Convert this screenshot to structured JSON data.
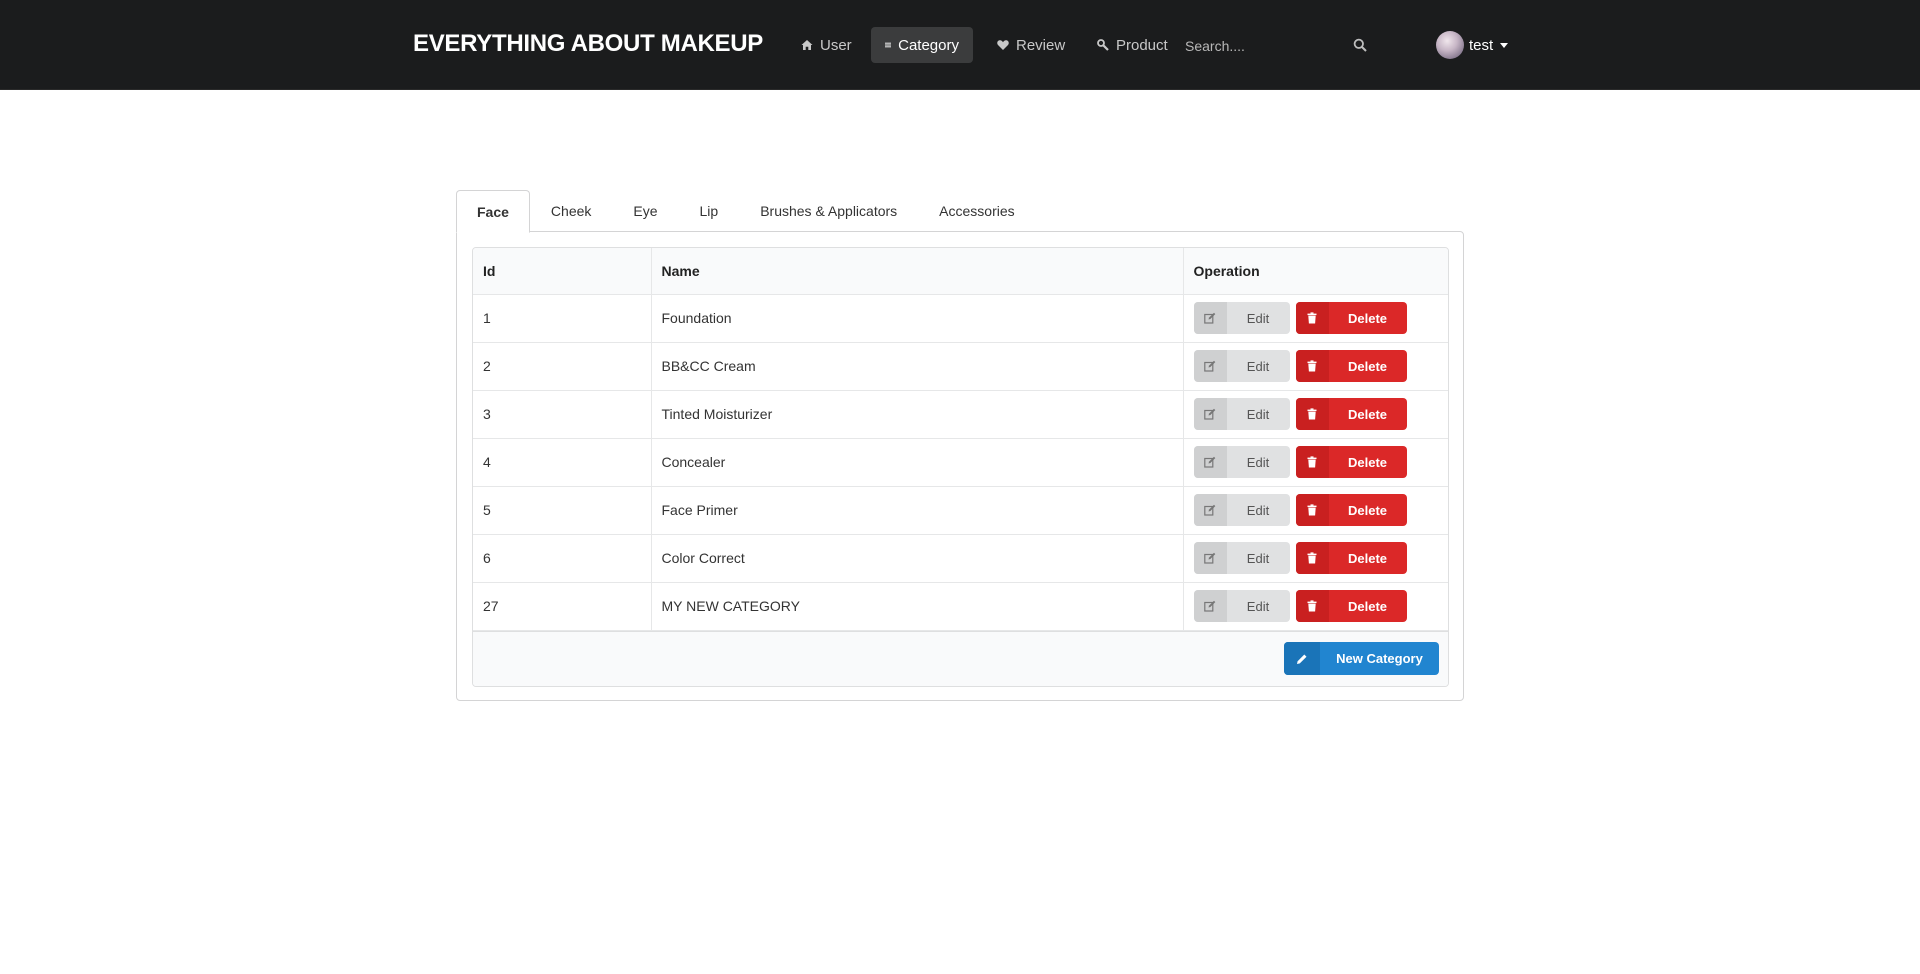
{
  "nav": {
    "brand": "EVERYTHING ABOUT MAKEUP",
    "items": [
      {
        "label": "User",
        "icon": "home-icon"
      },
      {
        "label": "Category",
        "icon": "list-icon",
        "active": true
      },
      {
        "label": "Review",
        "icon": "heart-icon"
      },
      {
        "label": "Product",
        "icon": "wrench-icon"
      }
    ],
    "search": {
      "placeholder": "Search....",
      "value": ""
    },
    "user": {
      "name": "test"
    }
  },
  "tabs": [
    {
      "label": "Face",
      "active": true
    },
    {
      "label": "Cheek"
    },
    {
      "label": "Eye"
    },
    {
      "label": "Lip"
    },
    {
      "label": "Brushes & Applicators"
    },
    {
      "label": "Accessories"
    }
  ],
  "table": {
    "headers": {
      "id": "Id",
      "name": "Name",
      "operation": "Operation"
    },
    "rows": [
      {
        "id": "1",
        "name": "Foundation"
      },
      {
        "id": "2",
        "name": "BB&CC Cream"
      },
      {
        "id": "3",
        "name": "Tinted Moisturizer"
      },
      {
        "id": "4",
        "name": "Concealer"
      },
      {
        "id": "5",
        "name": "Face Primer"
      },
      {
        "id": "6",
        "name": "Color Correct"
      },
      {
        "id": "27",
        "name": "MY NEW CATEGORY"
      }
    ],
    "edit_label": "Edit",
    "delete_label": "Delete",
    "new_label": "New Category"
  },
  "colors": {
    "navbar": "#1b1c1d",
    "delete": "#db2828",
    "primary": "#2185d0",
    "edit": "#e0e1e2"
  }
}
